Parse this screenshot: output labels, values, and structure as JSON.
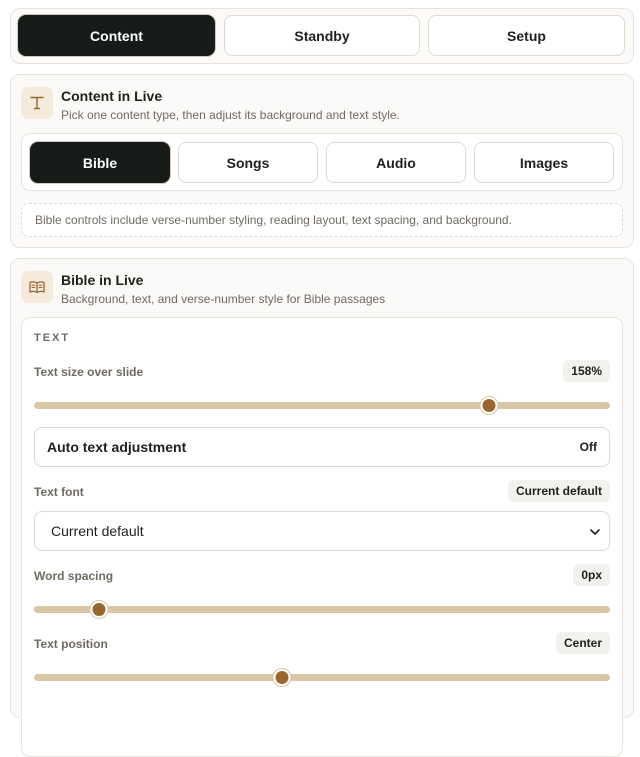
{
  "mode_tabs": [
    {
      "label": "Content",
      "active": true
    },
    {
      "label": "Standby",
      "active": false
    },
    {
      "label": "Setup",
      "active": false
    }
  ],
  "content_card": {
    "icon": "text-t-icon",
    "title": "Content in Live",
    "subtitle": "Pick one content type, then adjust its background and text style.",
    "types": [
      {
        "label": "Bible",
        "active": true
      },
      {
        "label": "Songs",
        "active": false
      },
      {
        "label": "Audio",
        "active": false
      },
      {
        "label": "Images",
        "active": false
      }
    ],
    "note": "Bible controls include verse-number styling, reading layout, text spacing, and background."
  },
  "bible_card": {
    "icon": "open-book-icon",
    "title": "Bible in Live",
    "subtitle": "Background, text, and verse-number style for Bible passages",
    "section_label": "TEXT",
    "text_size": {
      "label": "Text size over slide",
      "value": "158%",
      "fraction": 0.79
    },
    "auto_adjust": {
      "label": "Auto text adjustment",
      "state": "Off"
    },
    "font": {
      "label": "Text font",
      "badge": "Current default",
      "selected": "Current default"
    },
    "word_spacing": {
      "label": "Word spacing",
      "value": "0px",
      "fraction": 0.113
    },
    "text_position": {
      "label": "Text position",
      "value": "Center",
      "fraction": 0.43
    }
  },
  "colors": {
    "accent": "#9a6630",
    "track": "#d8c6a5",
    "active": "#161b17"
  }
}
